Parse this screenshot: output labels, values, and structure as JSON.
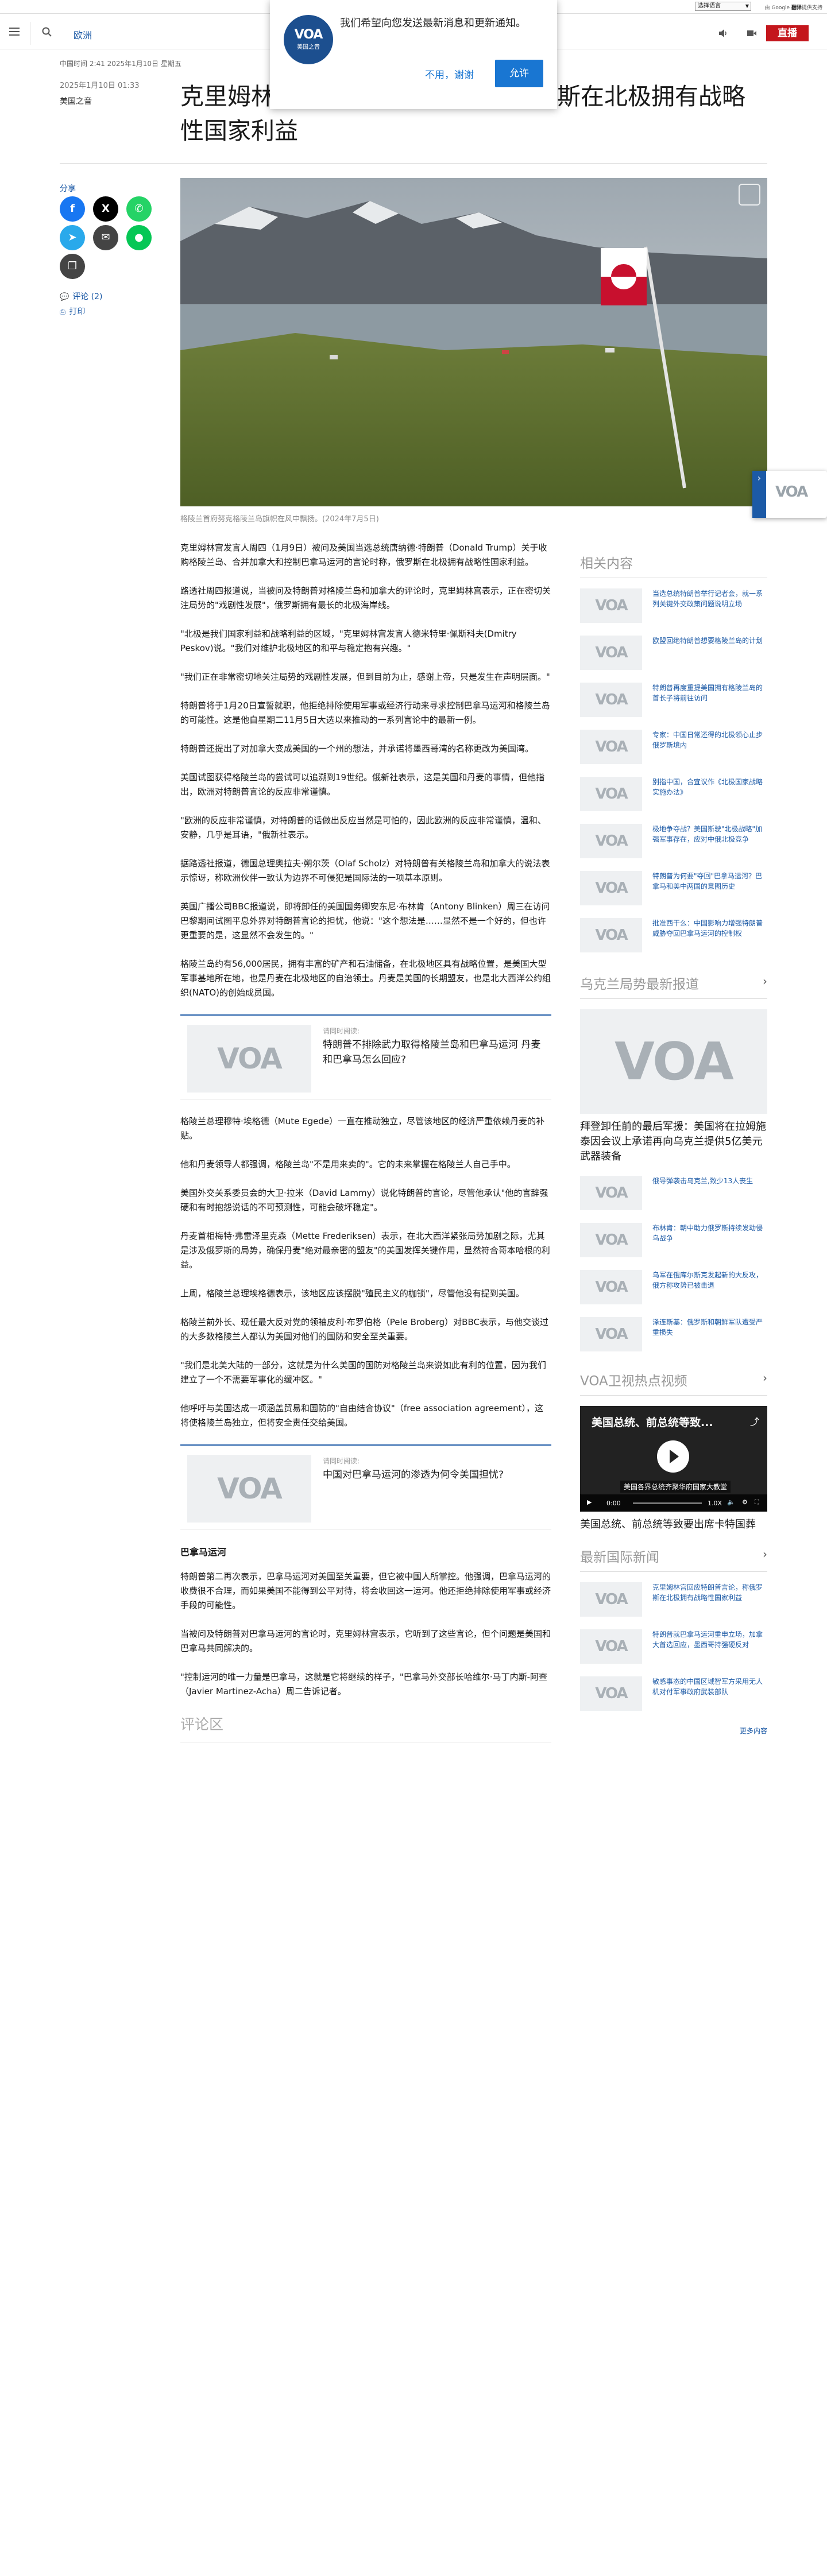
{
  "translate": {
    "select_label": "选择语言",
    "provided_by": "由 Google",
    "provided_brand": "翻译",
    "provided_suffix": "提供支持"
  },
  "header": {
    "section": "欧洲",
    "live_label": "直播"
  },
  "notification": {
    "message": "我们希望向您发送最新消息和更新通知。",
    "later": "不用，谢谢",
    "allow": "允许",
    "logo_text": "VOA",
    "logo_sub": "美国之音"
  },
  "article": {
    "updated": "中国时间 2:41 2025年1月10日 星期五",
    "date": "2025年1月10日 01:33",
    "category": "美国之音",
    "headline": "克里姆林宫回应特朗普言论，称俄罗斯在北极拥有战略性国家利益",
    "caption": "格陵兰首府努克格陵兰岛旗帜在风中飘扬。(2024年7月5日)",
    "share_label": "分享",
    "comments_link": "评论 (2)",
    "print_link": "打印",
    "paragraphs_a": [
      "克里姆林宫发言人周四（1月9日）被问及美国当选总统唐纳德·特朗普（Donald Trump）关于收购格陵兰岛、合并加拿大和控制巴拿马运河的言论时称，俄罗斯在北极拥有战略性国家利益。",
      "路透社周四报道说，当被问及特朗普对格陵兰岛和加拿大的评论时，克里姆林宫表示，正在密切关注局势的\"戏剧性发展\"，俄罗斯拥有最长的北极海岸线。",
      "\"北极是我们国家利益和战略利益的区域，\"克里姆林宫发言人德米特里·佩斯科夫(Dmitry Peskov)说。\"我们对维护北极地区的和平与稳定抱有兴趣。\"",
      "\"我们正在非常密切地关注局势的戏剧性发展，但到目前为止，感谢上帝，只是发生在声明层面。\"",
      "特朗普将于1月20日宣誓就职，他拒绝排除使用军事或经济行动来寻求控制巴拿马运河和格陵兰岛的可能性。这是他自星期二11月5日大选以来推动的一系列言论中的最新一例。",
      "特朗普还提出了对加拿大变成美国的一个州的想法，并承诺将墨西哥湾的名称更改为美国湾。",
      "美国试图获得格陵兰岛的尝试可以追溯到19世纪。俄新社表示，这是美国和丹麦的事情，但他指出，欧洲对特朗普言论的反应非常谨慎。",
      "\"欧洲的反应非常谨慎，对特朗普的话做出反应当然是可怕的，因此欧洲的反应非常谨慎，温和、安静，几乎是耳语，\"俄新社表示。",
      "据路透社报道，德国总理奥拉夫·朔尔茨（Olaf Scholz）对特朗普有关格陵兰岛和加拿大的说法表示惊讶，称欧洲伙伴一致认为边界不可侵犯是国际法的一项基本原则。",
      "英国广播公司BBC报道说，即将卸任的美国国务卿安东尼·布林肯（Antony Blinken）周三在访问巴黎期间试图平息外界对特朗普言论的担忧，他说：\"这个想法是……显然不是一个好的，但也许更重要的是，这显然不会发生的。\"",
      "格陵兰岛约有56,000居民，拥有丰富的矿产和石油储备，在北极地区具有战略位置，是美国大型军事基地所在地，也是丹麦在北极地区的自治领土。丹麦是美国的长期盟友，也是北大西洋公约组织(NATO)的创始成员国。"
    ],
    "embed1": {
      "label": "请同时阅读:",
      "title": "特朗普不排除武力取得格陵兰岛和巴拿马运河 丹麦和巴拿马怎么回应?"
    },
    "paragraphs_b": [
      "格陵兰总理穆特·埃格德（Mute Egede）一直在推动独立，尽管该地区的经济严重依赖丹麦的补贴。",
      "他和丹麦领导人都强调，格陵兰岛\"不是用来卖的\"。它的未来掌握在格陵兰人自己手中。",
      "美国外交关系委员会的大卫·拉米（David Lammy）说化特朗普的言论，尽管他承认\"他的言辞强硬和有时抱怨说话的不可预测性，可能会破坏稳定\"。",
      "丹麦首相梅特·弗雷泽里克森（Mette Frederiksen）表示，在北大西洋紧张局势加剧之际，尤其是涉及俄罗斯的局势，确保丹麦\"绝对最亲密的盟友\"的美国发挥关键作用，显然符合哥本哈根的利益。",
      "上周，格陵兰总理埃格德表示，该地区应该摆脱\"殖民主义的枷锁\"，尽管他没有提到美国。",
      "格陵兰前外长、现任最大反对党的领袖皮利·布罗伯格（Pele Broberg）对BBC表示，与他交谈过的大多数格陵兰人都认为美国对他们的国防和安全至关重要。",
      "\"我们是北美大陆的一部分，这就是为什么美国的国防对格陵兰岛来说如此有利的位置，因为我们建立了一个不需要军事化的缓冲区。\"",
      "他呼吁与美国达成一项涵盖贸易和国防的\"自由结合协议\"（free association agreement），这将使格陵兰岛独立，但将安全责任交给美国。"
    ],
    "embed2": {
      "label": "请同时阅读:",
      "title": "中国对巴拿马运河的渗透为何令美国担忧?"
    },
    "subhead": "巴拿马运河",
    "paragraphs_c": [
      "特朗普第二再次表示，巴拿马运河对美国至关重要，但它被中国人所掌控。他强调，巴拿马运河的收费很不合理，而如果美国不能得到公平对待，将会收回这一运河。他还拒绝排除使用军事或经济手段的可能性。",
      "当被问及特朗普对巴拿马运河的言论时，克里姆林宫表示，它听到了这些言论，但个问题是美国和巴拿马共同解决的。",
      "\"控制运河的唯一力量是巴拿马，这就是它将继续的样子，\"巴拿马外交部长哈维尔·马丁内斯-阿查（Javier Martinez-Acha）周二告诉记者。"
    ],
    "comments_heading": "评论区"
  },
  "rail": {
    "related_heading": "相关内容",
    "related": [
      "当选总统特朗普举行记者会，就一系列关键外交政策问题说明立场",
      "欧盟回绝特朗普想要格陵兰岛的计划",
      "特朗普再度重提美国拥有格陵兰岛的首长子将前往访问",
      "专家：中国日常还得的北极领心止步俄罗斯境内",
      "别指中国，合宜议作《北极国家战略实施办法》",
      "极地争夺战？美国斯驶\"北极战略\"加强军事存在，应对中俄北极竞争",
      "特朗普为何要\"夺回\"巴拿马运河？巴拿马和美中两国的意图历史",
      "批准西干么：中国影响力增强特朗普威胁夺回巴拿马运河的控制权"
    ],
    "ukraine_heading": "乌克兰局势最新报道",
    "ukraine_feature": "拜登卸任前的最后军援：美国将在拉姆施泰因会议上承诺再向乌克兰提供5亿美元武器装备",
    "ukraine": [
      "俄导弹袭击乌克兰,致少13人丧生",
      "布林肯：朝中助力俄罗斯持续发动侵乌战争",
      "乌军在俄库尔斯克发起新的大反攻，俄方称攻势已被击退",
      "泽连斯基：俄罗斯和朝鲜军队遭受严重损失"
    ],
    "video_heading": "VOA卫视热点视频",
    "video": {
      "title": "美国总统、前总统等致...",
      "subtitle": "美国各界总统齐聚华府国家大教堂",
      "time": "0:00",
      "speed": "1.0X",
      "caption": "美国总统、前总统等致要出席卡特国葬"
    },
    "news_heading": "最新国际新闻",
    "news": [
      "克里姆林宫回应特朗普言论，称俄罗斯在北极拥有战略性国家利益",
      "特朗普就巴拿马运河重申立场，加拿大首选回应，墨西哥持强硬反对",
      "敏感事态的中国区域智军方采用无人机对付军事政府武装部队"
    ],
    "more": "更多内容"
  }
}
